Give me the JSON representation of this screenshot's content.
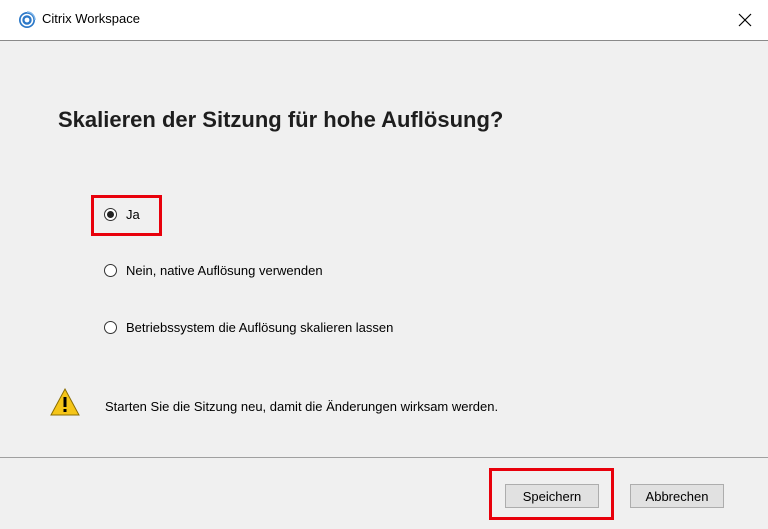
{
  "window": {
    "title": "Citrix Workspace",
    "close_glyph": "✕",
    "app_icon": "citrix-logo-icon"
  },
  "dialog": {
    "heading": "Skalieren der Sitzung für hohe Auflösung?",
    "options": [
      {
        "label": "Ja",
        "checked": true
      },
      {
        "label": "Nein, native Auflösung verwenden",
        "checked": false
      },
      {
        "label": "Betriebssystem die Auflösung skalieren lassen",
        "checked": false
      }
    ],
    "warning": {
      "icon": "warning-triangle-icon",
      "text": "Starten Sie die Sitzung neu, damit die Änderungen wirksam werden."
    }
  },
  "buttons": {
    "save_label": "Speichern",
    "cancel_label": "Abbrechen"
  },
  "colors": {
    "highlight": "#e8000b",
    "warning_fill": "#f5c518",
    "citrix_blue": "#2b78c8"
  }
}
